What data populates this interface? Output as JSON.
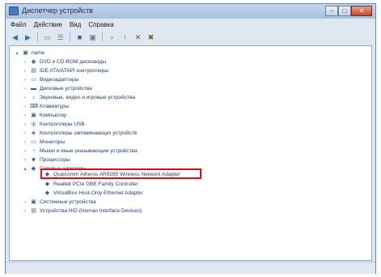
{
  "window": {
    "title": "Диспетчер устройств"
  },
  "menu": [
    "Файл",
    "Действие",
    "Вид",
    "Справка"
  ],
  "toolbar": {
    "icons": [
      "back-icon",
      "forward-icon",
      "properties-icon",
      "list-icon",
      "help-icon",
      "computer-icon",
      "scan-icon",
      "update-icon",
      "disable-icon",
      "uninstall-icon"
    ]
  },
  "tree": {
    "root": "name",
    "items": [
      "DVD и CD-ROM дисководы",
      "IDE ATA/ATAPI контроллеры",
      "Видеоадаптеры",
      "Дисковые устройства",
      "Звуковые, видео и игровые устройства",
      "Клавиатуры",
      "Компьютер",
      "Контроллеры USB",
      "Контроллеры запоминающих устройств",
      "Мониторы",
      "Мыши и иные указывающие устройства",
      "Процессоры",
      "Сетевые адаптеры"
    ],
    "network_children": [
      "Qualcomm Atheros AR9285 Wireless Network Adapter",
      "Realtek PCIe GBE Family Controller",
      "VirtualBox Host-Only Ethernet Adapter"
    ],
    "after": [
      "Системные устройства",
      "Устройства HID (Human Interface Devices)"
    ]
  },
  "colors": {
    "highlight": "#d0121e",
    "text": "#1d3e73"
  }
}
